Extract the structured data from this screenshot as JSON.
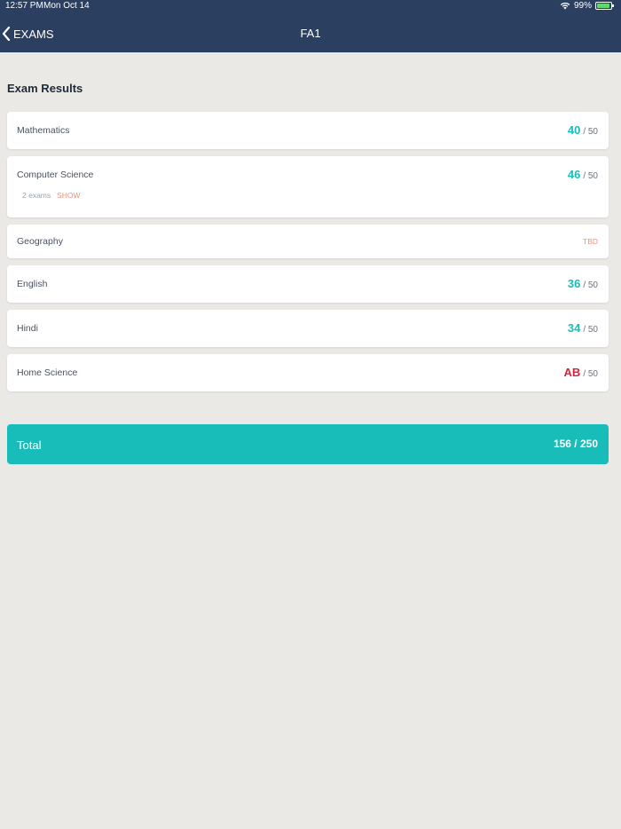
{
  "status_bar": {
    "time": "12:57 PM",
    "date": "Mon Oct 14",
    "battery": "99%"
  },
  "nav": {
    "back_label": "EXAMS",
    "title": "FA1"
  },
  "section_title": "Exam Results",
  "colors": {
    "accent": "#18bdb9",
    "absent": "#d8223b",
    "link": "#f0907a",
    "header": "#2b3f61"
  },
  "subjects": [
    {
      "name": "Mathematics",
      "score": "40",
      "max": "/ 50"
    },
    {
      "name": "Computer Science",
      "score": "46",
      "max": "/ 50",
      "exams_count": "2 exams",
      "show_label": "SHOW"
    },
    {
      "name": "Geography",
      "status": "TBD"
    },
    {
      "name": "English",
      "score": "36",
      "max": "/ 50"
    },
    {
      "name": "Hindi",
      "score": "34",
      "max": "/ 50"
    },
    {
      "name": "Home Science",
      "score": "AB",
      "max": "/ 50"
    }
  ],
  "total": {
    "label": "Total",
    "value": "156 / 250"
  }
}
